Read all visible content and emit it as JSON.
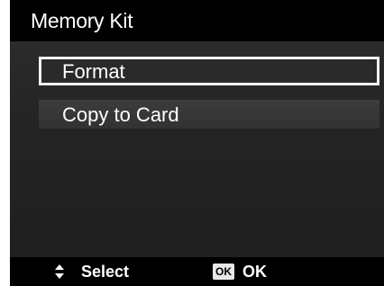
{
  "header": {
    "title": "Memory Kit"
  },
  "menu": {
    "selected_index": 0,
    "items": [
      {
        "label": "Format"
      },
      {
        "label": "Copy to Card"
      }
    ]
  },
  "footer": {
    "select_icon": "up-down-arrows-icon",
    "select_label": "Select",
    "ok_icon_text": "OK",
    "ok_label": "OK"
  },
  "colors": {
    "background": "#252525",
    "bars": "#000000",
    "text": "#ffffff",
    "highlight_border": "#f2f2f2"
  }
}
